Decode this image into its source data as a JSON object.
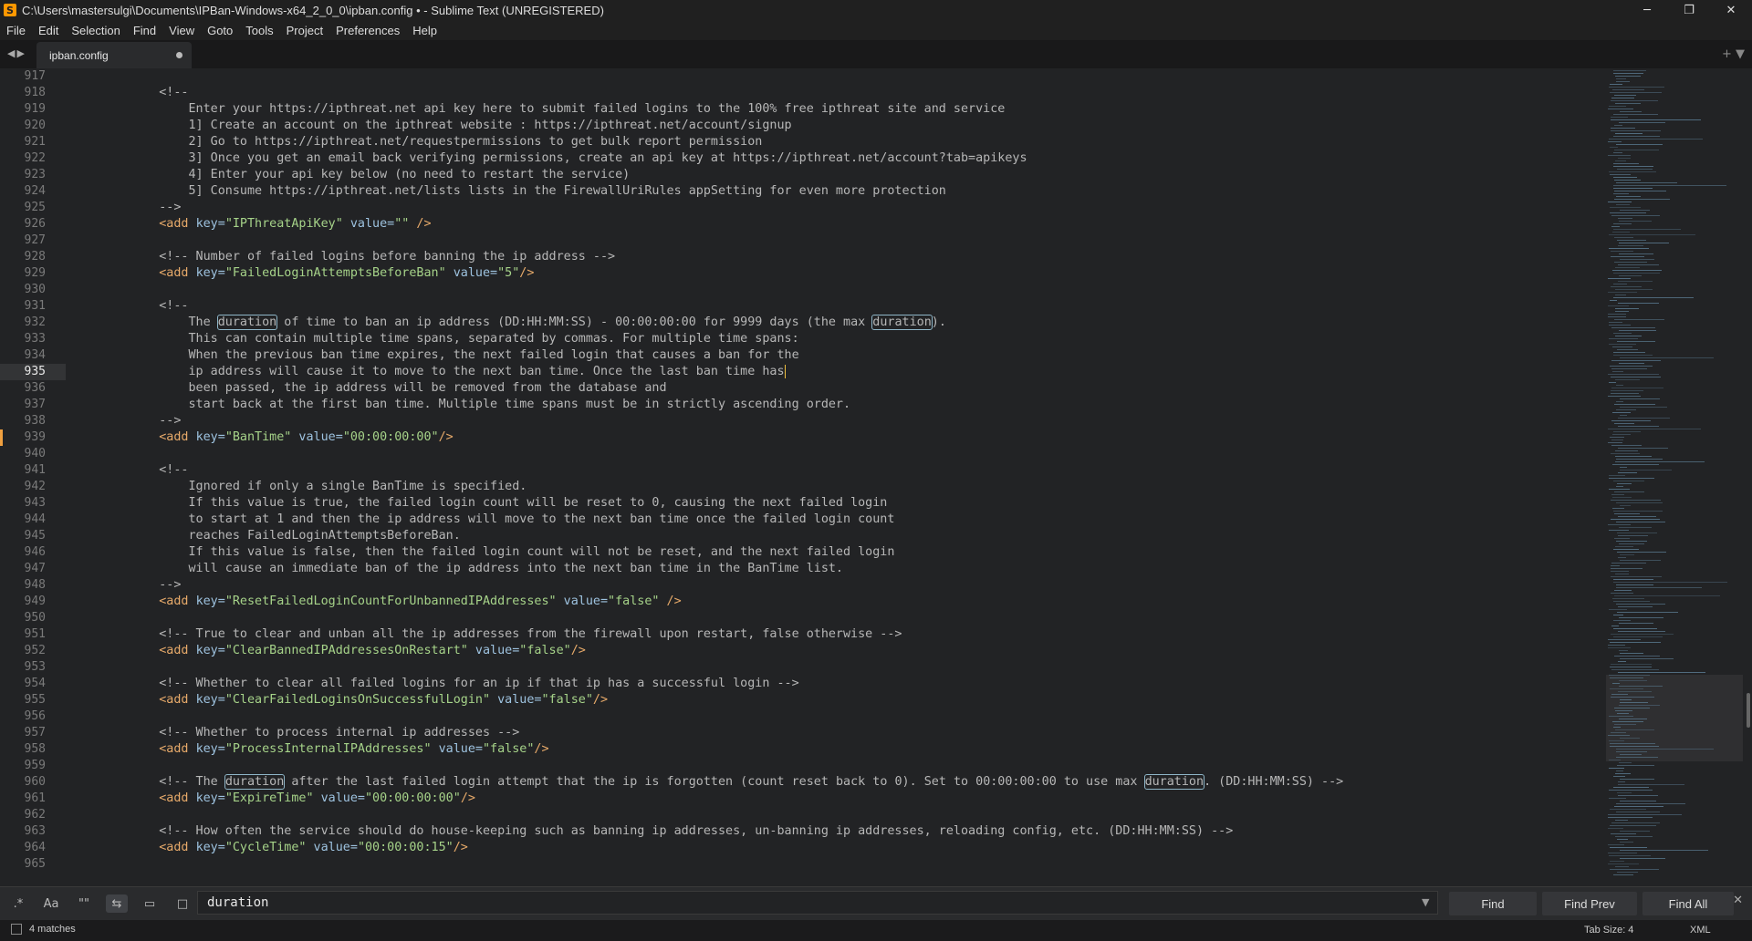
{
  "window": {
    "title": "C:\\Users\\mastersulgi\\Documents\\IPBan-Windows-x64_2_0_0\\ipban.config • - Sublime Text (UNREGISTERED)",
    "app_icon_glyph": "S",
    "minimize_glyph": "─",
    "maximize_glyph": "❐",
    "close_glyph": "✕"
  },
  "menu": [
    "File",
    "Edit",
    "Selection",
    "Find",
    "View",
    "Goto",
    "Tools",
    "Project",
    "Preferences",
    "Help"
  ],
  "tabs": {
    "nav_glyph": "◀▶",
    "active_label": "ipban.config",
    "right_glyphs": "+ ▼"
  },
  "editor": {
    "current_line": 935,
    "modified_line": 939,
    "lines": [
      {
        "n": "917",
        "segs": []
      },
      {
        "n": "918",
        "segs": [
          {
            "c": "comment",
            "t": "    <!--"
          }
        ]
      },
      {
        "n": "919",
        "segs": [
          {
            "c": "comment",
            "t": "        Enter your https://ipthreat.net api key here to submit failed logins to the 100% free ipthreat site and service"
          }
        ]
      },
      {
        "n": "920",
        "segs": [
          {
            "c": "comment",
            "t": "        1] Create an account on the ipthreat website : https://ipthreat.net/account/signup"
          }
        ]
      },
      {
        "n": "921",
        "segs": [
          {
            "c": "comment",
            "t": "        2] Go to https://ipthreat.net/requestpermissions to get bulk report permission"
          }
        ]
      },
      {
        "n": "922",
        "segs": [
          {
            "c": "comment",
            "t": "        3] Once you get an email back verifying permissions, create an api key at https://ipthreat.net/account?tab=apikeys"
          }
        ]
      },
      {
        "n": "923",
        "segs": [
          {
            "c": "comment",
            "t": "        4] Enter your api key below (no need to restart the service)"
          }
        ]
      },
      {
        "n": "924",
        "segs": [
          {
            "c": "comment",
            "t": "        5] Consume https://ipthreat.net/lists lists in the FirewallUriRules appSetting for even more protection"
          }
        ]
      },
      {
        "n": "925",
        "segs": [
          {
            "c": "comment",
            "t": "    -->"
          }
        ]
      },
      {
        "n": "926",
        "segs": [
          {
            "c": "plain",
            "t": "    "
          },
          {
            "c": "tag",
            "t": "<add "
          },
          {
            "c": "attr",
            "t": "key="
          },
          {
            "c": "str",
            "t": "\"IPThreatApiKey\""
          },
          {
            "c": "attr",
            "t": " value="
          },
          {
            "c": "str",
            "t": "\"\""
          },
          {
            "c": "tag",
            "t": " />"
          }
        ]
      },
      {
        "n": "927",
        "segs": []
      },
      {
        "n": "928",
        "segs": [
          {
            "c": "comment",
            "t": "    <!-- Number of failed logins before banning the ip address -->"
          }
        ]
      },
      {
        "n": "929",
        "segs": [
          {
            "c": "plain",
            "t": "    "
          },
          {
            "c": "tag",
            "t": "<add "
          },
          {
            "c": "attr",
            "t": "key="
          },
          {
            "c": "str",
            "t": "\"FailedLoginAttemptsBeforeBan\""
          },
          {
            "c": "attr",
            "t": " value="
          },
          {
            "c": "str",
            "t": "\"5\""
          },
          {
            "c": "tag",
            "t": "/>"
          }
        ]
      },
      {
        "n": "930",
        "segs": []
      },
      {
        "n": "931",
        "segs": [
          {
            "c": "comment",
            "t": "    <!--"
          }
        ]
      },
      {
        "n": "932",
        "segs": [
          {
            "c": "comment",
            "t": "        The "
          },
          {
            "c": "comment hl",
            "t": "duration"
          },
          {
            "c": "comment",
            "t": " of time to ban an ip address (DD:HH:MM:SS) - 00:00:00:00 for 9999 days (the max "
          },
          {
            "c": "comment hl",
            "t": "duration"
          },
          {
            "c": "comment",
            "t": ")."
          }
        ]
      },
      {
        "n": "933",
        "segs": [
          {
            "c": "comment",
            "t": "        This can contain multiple time spans, separated by commas. For multiple time spans:"
          }
        ]
      },
      {
        "n": "934",
        "segs": [
          {
            "c": "comment",
            "t": "        When the previous ban time expires, the next failed login that causes a ban for the"
          }
        ]
      },
      {
        "n": "935",
        "segs": [
          {
            "c": "comment",
            "t": "        ip address will cause it to move to the next ban time. Once the last ban time has"
          },
          {
            "c": "caret",
            "t": ""
          }
        ]
      },
      {
        "n": "936",
        "segs": [
          {
            "c": "comment",
            "t": "        been passed, the ip address will be removed from the database and"
          }
        ]
      },
      {
        "n": "937",
        "segs": [
          {
            "c": "comment",
            "t": "        start back at the first ban time. Multiple time spans must be in strictly ascending order."
          }
        ]
      },
      {
        "n": "938",
        "segs": [
          {
            "c": "comment",
            "t": "    -->"
          }
        ]
      },
      {
        "n": "939",
        "segs": [
          {
            "c": "plain",
            "t": "    "
          },
          {
            "c": "tag",
            "t": "<add "
          },
          {
            "c": "attr",
            "t": "key="
          },
          {
            "c": "str",
            "t": "\"BanTime\""
          },
          {
            "c": "attr",
            "t": " value="
          },
          {
            "c": "str",
            "t": "\"00:00:00:00\""
          },
          {
            "c": "tag",
            "t": "/>"
          }
        ]
      },
      {
        "n": "940",
        "segs": []
      },
      {
        "n": "941",
        "segs": [
          {
            "c": "comment",
            "t": "    <!--"
          }
        ]
      },
      {
        "n": "942",
        "segs": [
          {
            "c": "comment",
            "t": "        Ignored if only a single BanTime is specified."
          }
        ]
      },
      {
        "n": "943",
        "segs": [
          {
            "c": "comment",
            "t": "        If this value is true, the failed login count will be reset to 0, causing the next failed login"
          }
        ]
      },
      {
        "n": "944",
        "segs": [
          {
            "c": "comment",
            "t": "        to start at 1 and then the ip address will move to the next ban time once the failed login count"
          }
        ]
      },
      {
        "n": "945",
        "segs": [
          {
            "c": "comment",
            "t": "        reaches FailedLoginAttemptsBeforeBan."
          }
        ]
      },
      {
        "n": "946",
        "segs": [
          {
            "c": "comment",
            "t": "        If this value is false, then the failed login count will not be reset, and the next failed login"
          }
        ]
      },
      {
        "n": "947",
        "segs": [
          {
            "c": "comment",
            "t": "        will cause an immediate ban of the ip address into the next ban time in the BanTime list."
          }
        ]
      },
      {
        "n": "948",
        "segs": [
          {
            "c": "comment",
            "t": "    -->"
          }
        ]
      },
      {
        "n": "949",
        "segs": [
          {
            "c": "plain",
            "t": "    "
          },
          {
            "c": "tag",
            "t": "<add "
          },
          {
            "c": "attr",
            "t": "key="
          },
          {
            "c": "str",
            "t": "\"ResetFailedLoginCountForUnbannedIPAddresses\""
          },
          {
            "c": "attr",
            "t": " value="
          },
          {
            "c": "str",
            "t": "\"false\""
          },
          {
            "c": "tag",
            "t": " />"
          }
        ]
      },
      {
        "n": "950",
        "segs": []
      },
      {
        "n": "951",
        "segs": [
          {
            "c": "comment",
            "t": "    <!-- True to clear and unban all the ip addresses from the firewall upon restart, false otherwise -->"
          }
        ]
      },
      {
        "n": "952",
        "segs": [
          {
            "c": "plain",
            "t": "    "
          },
          {
            "c": "tag",
            "t": "<add "
          },
          {
            "c": "attr",
            "t": "key="
          },
          {
            "c": "str",
            "t": "\"ClearBannedIPAddressesOnRestart\""
          },
          {
            "c": "attr",
            "t": " value="
          },
          {
            "c": "str",
            "t": "\"false\""
          },
          {
            "c": "tag",
            "t": "/>"
          }
        ]
      },
      {
        "n": "953",
        "segs": []
      },
      {
        "n": "954",
        "segs": [
          {
            "c": "comment",
            "t": "    <!-- Whether to clear all failed logins for an ip if that ip has a successful login -->"
          }
        ]
      },
      {
        "n": "955",
        "segs": [
          {
            "c": "plain",
            "t": "    "
          },
          {
            "c": "tag",
            "t": "<add "
          },
          {
            "c": "attr",
            "t": "key="
          },
          {
            "c": "str",
            "t": "\"ClearFailedLoginsOnSuccessfulLogin\""
          },
          {
            "c": "attr",
            "t": " value="
          },
          {
            "c": "str",
            "t": "\"false\""
          },
          {
            "c": "tag",
            "t": "/>"
          }
        ]
      },
      {
        "n": "956",
        "segs": []
      },
      {
        "n": "957",
        "segs": [
          {
            "c": "comment",
            "t": "    <!-- Whether to process internal ip addresses -->"
          }
        ]
      },
      {
        "n": "958",
        "segs": [
          {
            "c": "plain",
            "t": "    "
          },
          {
            "c": "tag",
            "t": "<add "
          },
          {
            "c": "attr",
            "t": "key="
          },
          {
            "c": "str",
            "t": "\"ProcessInternalIPAddresses\""
          },
          {
            "c": "attr",
            "t": " value="
          },
          {
            "c": "str",
            "t": "\"false\""
          },
          {
            "c": "tag",
            "t": "/>"
          }
        ]
      },
      {
        "n": "959",
        "segs": []
      },
      {
        "n": "960",
        "segs": [
          {
            "c": "comment",
            "t": "    <!-- The "
          },
          {
            "c": "comment hl",
            "t": "duration"
          },
          {
            "c": "comment",
            "t": " after the last failed login attempt that the ip is forgotten (count reset back to 0). Set to 00:00:00:00 to use max "
          },
          {
            "c": "comment hl",
            "t": "duration"
          },
          {
            "c": "comment",
            "t": ". (DD:HH:MM:SS) -->"
          }
        ]
      },
      {
        "n": "961",
        "segs": [
          {
            "c": "plain",
            "t": "    "
          },
          {
            "c": "tag",
            "t": "<add "
          },
          {
            "c": "attr",
            "t": "key="
          },
          {
            "c": "str",
            "t": "\"ExpireTime\""
          },
          {
            "c": "attr",
            "t": " value="
          },
          {
            "c": "str",
            "t": "\"00:00:00:00\""
          },
          {
            "c": "tag",
            "t": "/>"
          }
        ]
      },
      {
        "n": "962",
        "segs": []
      },
      {
        "n": "963",
        "segs": [
          {
            "c": "comment",
            "t": "    <!-- How often the service should do house-keeping such as banning ip addresses, un-banning ip addresses, reloading config, etc. (DD:HH:MM:SS) -->"
          }
        ]
      },
      {
        "n": "964",
        "segs": [
          {
            "c": "plain",
            "t": "    "
          },
          {
            "c": "tag",
            "t": "<add "
          },
          {
            "c": "attr",
            "t": "key="
          },
          {
            "c": "str",
            "t": "\"CycleTime\""
          },
          {
            "c": "attr",
            "t": " value="
          },
          {
            "c": "str",
            "t": "\"00:00:00:15\""
          },
          {
            "c": "tag",
            "t": "/>"
          }
        ]
      },
      {
        "n": "965",
        "segs": []
      }
    ]
  },
  "find_panel": {
    "regex_glyph": ".*",
    "case_glyph": "Aa",
    "word_glyph": "\"\"",
    "wrap_glyph": "⇆",
    "insel_glyph": "▭",
    "highlight_glyph": "□",
    "query": "duration",
    "dropdown_glyph": "▼",
    "find_label": "Find",
    "find_prev_label": "Find Prev",
    "find_all_label": "Find All",
    "close_glyph": "✕"
  },
  "status": {
    "matches": "4 matches",
    "tab_size": "Tab Size: 4",
    "syntax": "XML"
  },
  "colors": {
    "background": "#222325",
    "comment": "#b7b7b7",
    "tag": "#e7aa6a",
    "string": "#a6d389",
    "caret": "#f0c040",
    "modified_marker": "#f0a040"
  }
}
